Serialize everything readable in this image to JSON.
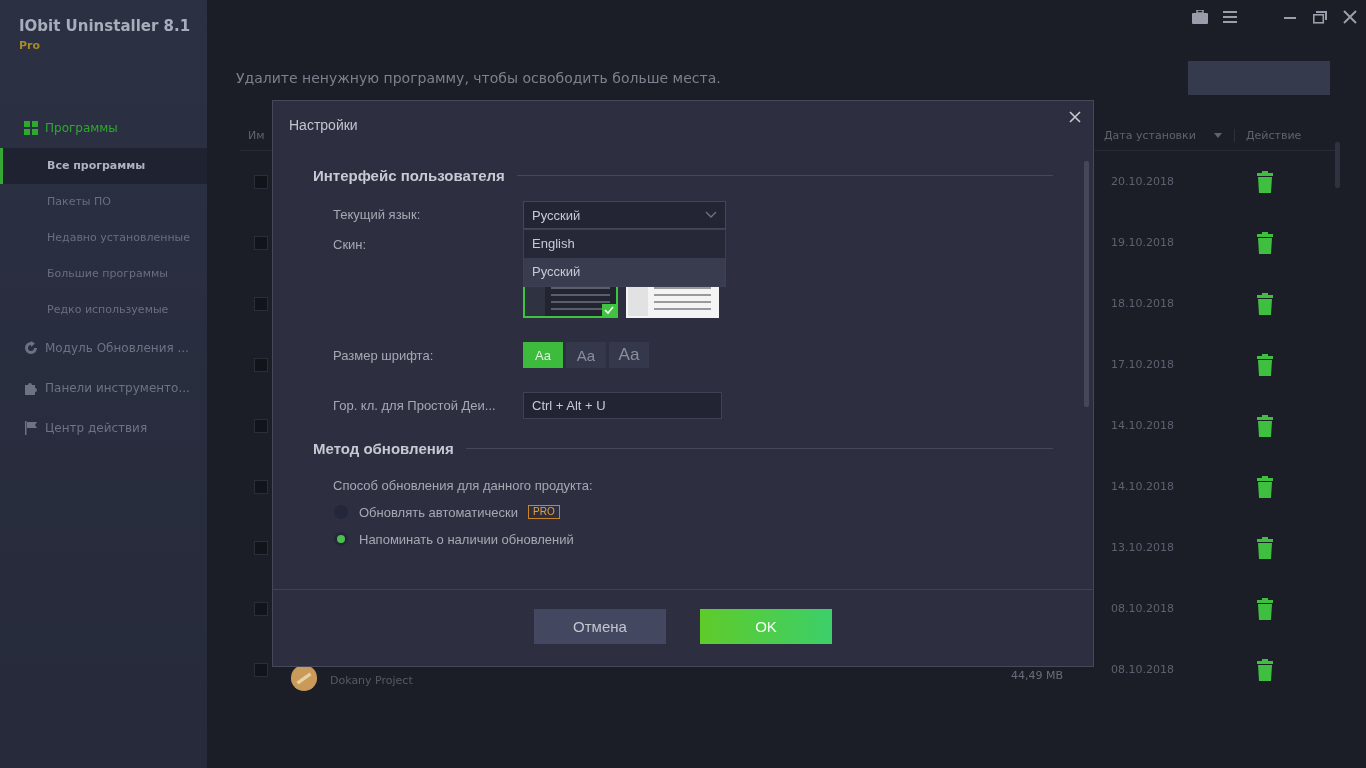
{
  "app": {
    "title": "IObit Uninstaller 8.1",
    "edition": "Pro",
    "headline": "Удалите ненужную программу, чтобы освободить больше места.",
    "nav": [
      {
        "label": "Программы",
        "selected": true,
        "children": [
          {
            "label": "Все программы",
            "selected": true
          },
          {
            "label": "Пакеты ПО",
            "selected": false
          },
          {
            "label": "Недавно установленные",
            "selected": false
          },
          {
            "label": "Большие программы",
            "selected": false
          },
          {
            "label": "Редко используемые",
            "selected": false
          }
        ]
      },
      {
        "label": "Модуль Обновления ...",
        "selected": false
      },
      {
        "label": "Панели инструменто...",
        "selected": false
      },
      {
        "label": "Центр действия",
        "selected": false
      }
    ]
  },
  "table": {
    "columns": [
      "Им",
      "Дата установки",
      "Действие"
    ],
    "rows": [
      {
        "date": "20.10.2018",
        "checked": false
      },
      {
        "date": "19.10.2018",
        "checked": false
      },
      {
        "date": "18.10.2018",
        "checked": false
      },
      {
        "date": "17.10.2018",
        "checked": false
      },
      {
        "date": "14.10.2018",
        "checked": false
      },
      {
        "date": "14.10.2018",
        "checked": false
      },
      {
        "date": "13.10.2018",
        "checked": false
      },
      {
        "date": "08.10.2018",
        "checked": false
      },
      {
        "date": "08.10.2018",
        "checked": false,
        "publisher": "Dokany Project",
        "size": "44,49 MB"
      }
    ]
  },
  "dialog": {
    "title": "Настройки",
    "ui_section": {
      "heading": "Интерфейс пользователя",
      "language": {
        "label": "Текущий язык:",
        "value": "Русский",
        "expanded": true,
        "options": [
          {
            "label": "English",
            "selected": false
          },
          {
            "label": "Русский",
            "selected": true
          }
        ]
      },
      "skin": {
        "label": "Скин:",
        "options": [
          {
            "kind": "dark",
            "selected": true
          },
          {
            "kind": "light",
            "selected": false
          }
        ]
      },
      "font_size": {
        "label": "Размер шрифта:",
        "options": [
          {
            "label": "Aa",
            "selected": true
          },
          {
            "label": "Aa",
            "selected": false
          },
          {
            "label": "Aa",
            "selected": false
          }
        ]
      },
      "hotkey": {
        "label": "Гор. кл. для Простой Деи...",
        "value": "Ctrl + Alt + U"
      }
    },
    "update_section": {
      "heading": "Метод обновления",
      "prompt": "Способ обновления для данного продукта:",
      "options": [
        {
          "label": "Обновлять автоматически",
          "badge": "PRO",
          "selected": false
        },
        {
          "label": "Напоминать о наличии обновлений",
          "selected": true
        }
      ]
    },
    "buttons": [
      {
        "label": "Отмена",
        "kind": "secondary"
      },
      {
        "label": "OK",
        "kind": "primary"
      }
    ]
  }
}
